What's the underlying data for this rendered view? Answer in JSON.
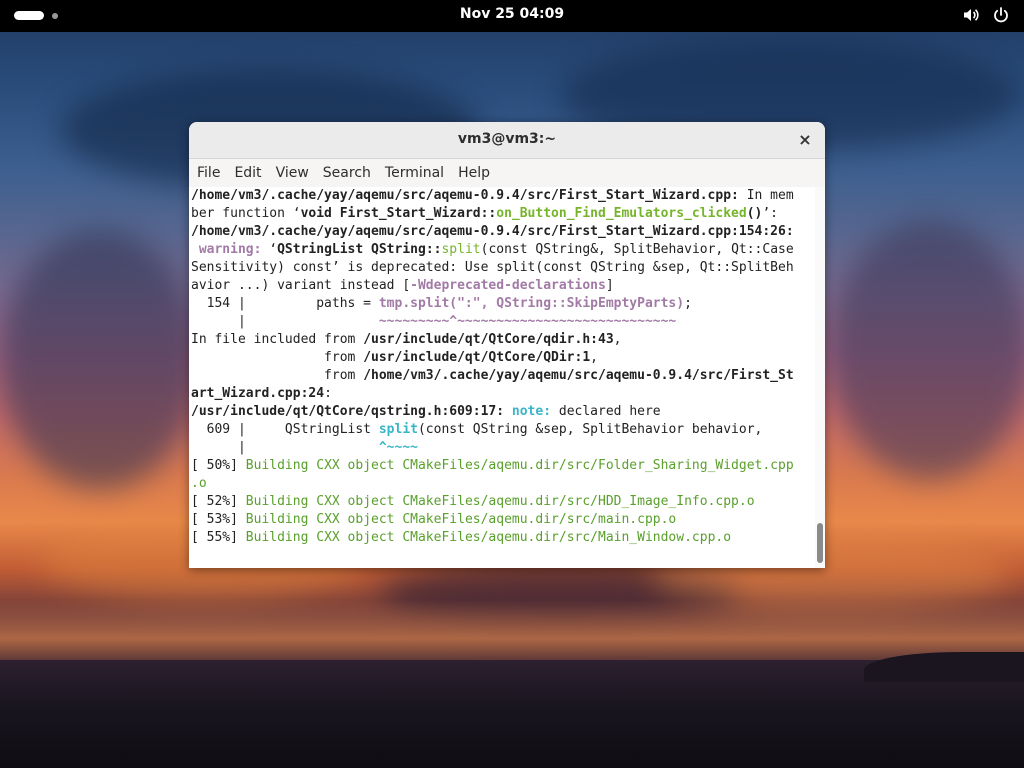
{
  "topbar": {
    "clock": "Nov 25  04:09",
    "icons": [
      "activities-pill",
      "volume-icon",
      "power-icon"
    ]
  },
  "window": {
    "title": "vm3@vm3:~",
    "close_label": "×",
    "menu": [
      "File",
      "Edit",
      "View",
      "Search",
      "Terminal",
      "Help"
    ]
  },
  "terminal": {
    "lines": [
      [
        {
          "t": "/home/vm3/.cache/yay/aqemu/src/aqemu-0.9.4/src/First_Start_Wizard.cpp:",
          "c": "b"
        },
        {
          "t": " In mem",
          "c": ""
        }
      ],
      [
        {
          "t": "ber function ‘",
          "c": ""
        },
        {
          "t": "void First_Start_Wizard::",
          "c": "b"
        },
        {
          "t": "on_Button_Find_Emulators_clicked",
          "c": "fn b"
        },
        {
          "t": "()",
          "c": "b"
        },
        {
          "t": "’:",
          "c": ""
        }
      ],
      [
        {
          "t": "/home/vm3/.cache/yay/aqemu/src/aqemu-0.9.4/src/First_Start_Wizard.cpp:154:26:",
          "c": "b"
        }
      ],
      [
        {
          "t": " warning: ",
          "c": "warn"
        },
        {
          "t": "‘",
          "c": ""
        },
        {
          "t": "QStringList QString::",
          "c": "b"
        },
        {
          "t": "split",
          "c": "fn"
        },
        {
          "t": "(const QString&, SplitBehavior, Qt::Case",
          "c": ""
        }
      ],
      [
        {
          "t": "Sensitivity) const’ is deprecated: Use split(const QString &sep, Qt::SplitBeh",
          "c": ""
        }
      ],
      [
        {
          "t": "avior ...) variant instead [",
          "c": ""
        },
        {
          "t": "-Wdeprecated-declarations",
          "c": "warn"
        },
        {
          "t": "]",
          "c": ""
        }
      ],
      [
        {
          "t": "  154 |         paths = ",
          "c": ""
        },
        {
          "t": "tmp.split(\":\", QString::SkipEmptyParts)",
          "c": "warn"
        },
        {
          "t": ";",
          "c": ""
        }
      ],
      [
        {
          "t": "      |                 ",
          "c": ""
        },
        {
          "t": "~~~~~~~~~^~~~~~~~~~~~~~~~~~~~~~~~~~~~~",
          "c": "warn"
        }
      ],
      [
        {
          "t": "In file included from ",
          "c": ""
        },
        {
          "t": "/usr/include/qt/QtCore/qdir.h:43",
          "c": "b"
        },
        {
          "t": ",",
          "c": ""
        }
      ],
      [
        {
          "t": "                 from ",
          "c": ""
        },
        {
          "t": "/usr/include/qt/QtCore/QDir:1",
          "c": "b"
        },
        {
          "t": ",",
          "c": ""
        }
      ],
      [
        {
          "t": "                 from ",
          "c": ""
        },
        {
          "t": "/home/vm3/.cache/yay/aqemu/src/aqemu-0.9.4/src/First_St",
          "c": "b"
        }
      ],
      [
        {
          "t": "art_Wizard.cpp:24",
          "c": "b"
        },
        {
          "t": ":",
          "c": ""
        }
      ],
      [
        {
          "t": "/usr/include/qt/QtCore/qstring.h:609:17:",
          "c": "b"
        },
        {
          "t": " note: ",
          "c": "note"
        },
        {
          "t": "declared here",
          "c": ""
        }
      ],
      [
        {
          "t": "  609 |     QStringList ",
          "c": ""
        },
        {
          "t": "split",
          "c": "note"
        },
        {
          "t": "(const QString &sep, SplitBehavior behavior,",
          "c": ""
        }
      ],
      [
        {
          "t": "      |                 ",
          "c": ""
        },
        {
          "t": "^~~~~",
          "c": "note"
        }
      ],
      [
        {
          "t": "[ 50%] ",
          "c": ""
        },
        {
          "t": "Building CXX object CMakeFiles/aqemu.dir/src/Folder_Sharing_Widget.cpp",
          "c": "grn"
        }
      ],
      [
        {
          "t": ".o",
          "c": "grn"
        }
      ],
      [
        {
          "t": "[ 52%] ",
          "c": ""
        },
        {
          "t": "Building CXX object CMakeFiles/aqemu.dir/src/HDD_Image_Info.cpp.o",
          "c": "grn"
        }
      ],
      [
        {
          "t": "[ 53%] ",
          "c": ""
        },
        {
          "t": "Building CXX object CMakeFiles/aqemu.dir/src/main.cpp.o",
          "c": "grn"
        }
      ],
      [
        {
          "t": "[ 55%] ",
          "c": ""
        },
        {
          "t": "Building CXX object CMakeFiles/aqemu.dir/src/Main_Window.cpp.o",
          "c": "grn"
        }
      ]
    ]
  }
}
